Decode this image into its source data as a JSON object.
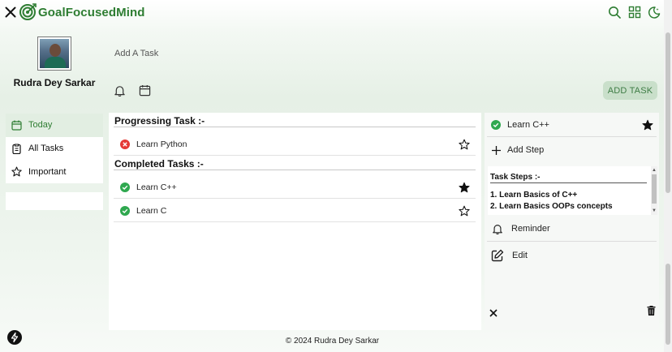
{
  "header": {
    "brand": "GoalFocusedMind",
    "icons": [
      "close-icon",
      "target-logo-icon",
      "search-icon",
      "grid-icon",
      "moon-icon"
    ],
    "accent": "#2e7d32"
  },
  "profile": {
    "name": "Rudra Dey Sarkar"
  },
  "sidebar": {
    "items": [
      {
        "label": "Today",
        "icon": "calendar-icon",
        "active": true
      },
      {
        "label": "All Tasks",
        "icon": "clipboard-icon",
        "active": false
      },
      {
        "label": "Important",
        "icon": "star-icon",
        "active": false
      }
    ]
  },
  "add_task": {
    "placeholder": "Add A Task",
    "button_label": "ADD TASK",
    "tool_icons": [
      "bell-icon",
      "calendar-icon"
    ]
  },
  "tasks": {
    "progressing_title": "Progressing Task :-",
    "completed_title": "Completed Tasks :-",
    "progressing": [
      {
        "label": "Learn Python",
        "status": "incomplete",
        "starred": false
      }
    ],
    "completed": [
      {
        "label": "Learn C++",
        "status": "complete",
        "starred": true
      },
      {
        "label": "Learn C",
        "status": "complete",
        "starred": false
      }
    ]
  },
  "detail": {
    "task_label": "Learn C++",
    "starred": true,
    "add_step_label": "Add Step",
    "steps_title": "Task Steps :-",
    "steps": [
      "1. Learn Basics of C++",
      "2. Learn Basics OOPs concepts"
    ],
    "reminder_label": "Reminder",
    "edit_label": "Edit"
  },
  "footer": {
    "text": "© 2024 Rudra Dey Sarkar"
  },
  "colors": {
    "complete": "#2fa84f",
    "incomplete": "#e53935",
    "button_bg": "#c9dfca"
  }
}
